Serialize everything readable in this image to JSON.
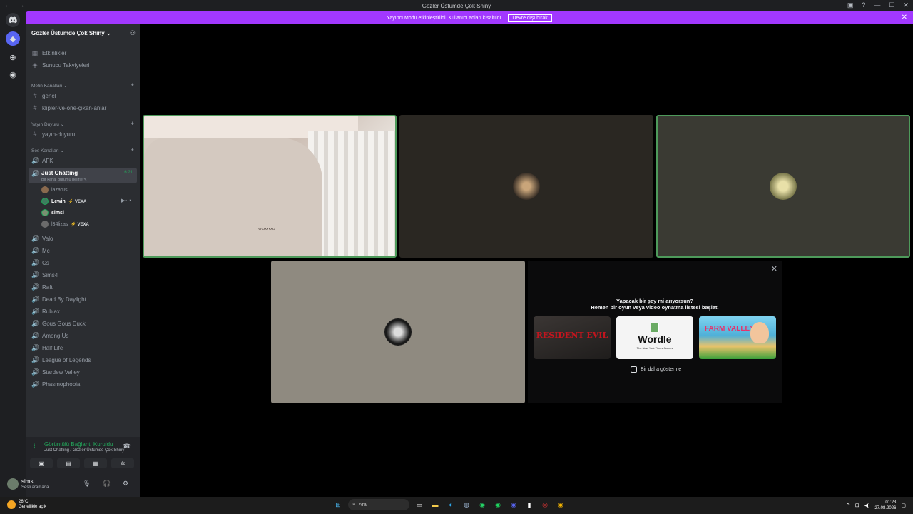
{
  "window": {
    "title": "Gözler Üstümde Çok Shiny",
    "nav": "← →",
    "controls": [
      "▣",
      "?",
      "—",
      "☐",
      "✕"
    ]
  },
  "banner": {
    "message": "Yayıncı Modu etkinleştirildi. Kullanıcı adları kısaltıldı.",
    "button": "Devre dışı bırak",
    "close": "✕"
  },
  "server": {
    "name": "Gözler Üstümde Çok Shiny ⌄",
    "top_items": [
      {
        "icon": "▦",
        "label": "Etkinlikler"
      },
      {
        "icon": "◈",
        "label": "Sunucu Takviyeleri"
      }
    ],
    "categories": {
      "text": "Metin Kanalları ⌄",
      "stage": "Yayın Duyuru ⌄",
      "voice": "Ses Kanalları ⌄"
    },
    "text_channels": [
      "genel",
      "klipler-ve-öne-çıkan-anlar"
    ],
    "stage_channels": [
      "yayın-duyuru"
    ],
    "voice_channels_top": [
      "AFK"
    ],
    "active_channel": {
      "name": "Just Chatting",
      "sub": "Bir kanal durumu belirle ✎",
      "time": "6:21"
    },
    "members": [
      {
        "name": "lazarus",
        "tag": ""
      },
      {
        "name": "Lewin",
        "tag": "⚡ VEXA"
      },
      {
        "name": "simsi",
        "tag": ""
      },
      {
        "name": "l34lizas",
        "tag": "⚡ VEXA"
      }
    ],
    "voice_channels": [
      "Valo",
      "Mc",
      "Cs",
      "Sims4",
      "Raft",
      "Dead By Daylight",
      "Rublax",
      "Gous Gous Duck",
      "Among Us",
      "Half Life",
      "League of Legends",
      "Stardew Valley",
      "Phasmophobia"
    ]
  },
  "voice_panel": {
    "title": "Görüntülü Bağlantı Kuruldu",
    "sub": "Just Chatting / Gözler Üstümde Çok Shiny"
  },
  "user": {
    "name": "simsi",
    "status": "Sesli aramada"
  },
  "promo": {
    "line1": "Yapacak bir şey mi arıyorsun?",
    "line2": "Hemen bir oyun veya video oynatma listesi başlat.",
    "cards": [
      {
        "label": "RESIDENT EVIL",
        "color": "#b3121b"
      },
      {
        "label": "Wordle",
        "sub": "The New York Times Games"
      },
      {
        "label": "FARM VALLEY"
      }
    ],
    "dont_show": "Bir daha gösterme"
  },
  "taskbar": {
    "temp": "26°C",
    "weather": "Genellikle açık",
    "search": "Ara",
    "time": "01:23",
    "date": "27.08.2026"
  },
  "colors": {
    "banner": "#a238ff",
    "speaking": "#4e9a5b",
    "online": "#23a55a"
  }
}
